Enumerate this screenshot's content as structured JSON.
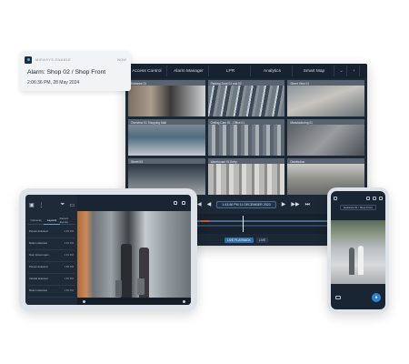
{
  "notification": {
    "app_name": "MIRASYS ENABLE",
    "time": "NOW",
    "title": "Alarm: Shop 02 / Shop Front",
    "subtitle": "2:06:36 PM, 28 May 2024"
  },
  "desktop": {
    "tabs": [
      "Access Control",
      "Alarm Manager",
      "LPR",
      "Analytics",
      "Smart Map"
    ],
    "more_icon": "chevron-down-icon",
    "add_icon": "plus-icon",
    "cameras": [
      {
        "label": "Entrance 01"
      },
      {
        "label": "Parking Zone 01 and 02"
      },
      {
        "label": "Street View 01"
      },
      {
        "label": "Overview 01 Shopping Mall"
      },
      {
        "label": "Ceiling Cam 01 - Office 01"
      },
      {
        "label": "Manufacturing 01"
      },
      {
        "label": "Street 03"
      },
      {
        "label": "Warehouse 01 Entry"
      },
      {
        "label": "Distribution"
      }
    ],
    "playback_timestamp": "1:43:56 PM 11 DECEMBER 2023",
    "bottom_buttons": [
      "LIVE PLAYBACK",
      "LIVE"
    ]
  },
  "tablet": {
    "side_tabs": [
      "Cameras",
      "Layouts",
      "Recent Events"
    ],
    "events": [
      {
        "label": "Person detected",
        "time": "2:05 PM"
      },
      {
        "label": "Motion detected",
        "time": "2:04 PM"
      },
      {
        "label": "Door forced open",
        "time": "2:01 PM"
      },
      {
        "label": "Person detected",
        "time": "1:58 PM"
      },
      {
        "label": "Vehicle detected",
        "time": "1:55 PM"
      },
      {
        "label": "Motion detected",
        "time": "1:50 PM"
      }
    ]
  },
  "phone": {
    "camera_label": "Entrance 01 / Shop Front"
  },
  "colors": {
    "dark_bg": "#1c2836",
    "accent": "#2d82d4",
    "alarm": "#c1563a"
  }
}
